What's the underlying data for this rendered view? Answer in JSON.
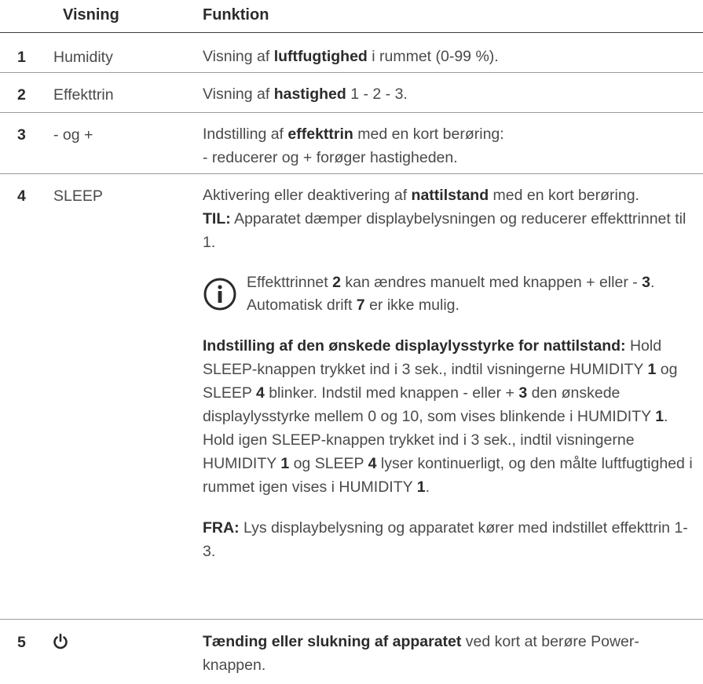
{
  "header": {
    "col_visning": "Visning",
    "col_funktion": "Funktion"
  },
  "rows": [
    {
      "num": "1",
      "visning": "Humidity",
      "f_pre": "Visning af ",
      "f_bold": "luftfugtighed",
      "f_post": " i rummet (0-99 %)."
    },
    {
      "num": "2",
      "visning": "Effekttrin",
      "f_pre": "Visning af ",
      "f_bold": "hastighed",
      "f_post": " 1 - 2 - 3."
    },
    {
      "num": "3",
      "visning": "- og +",
      "f_pre": "Indstilling af ",
      "f_bold": "effekttrin",
      "f_post": " med en kort berøring:",
      "f_line2": "- reducerer og + forøger hastigheden."
    },
    {
      "num": "4",
      "visning": "SLEEP",
      "p1_pre": "Aktivering eller deaktivering af ",
      "p1_bold": "nattilstand",
      "p1_post": " med en kort berøring.",
      "til_label": "TIL:",
      "til_text": " Apparatet dæmper displaybelysningen og reducerer effekttrinnet til 1.",
      "note": {
        "t1": "Effekttrinnet ",
        "b1": "2",
        "t2": " kan ændres manuelt med knappen + eller - ",
        "b2": "3",
        "t3": ". Automatisk drift ",
        "b3": "7",
        "t4": " er ikke mulig."
      },
      "p3_label": "Indstilling af den ønskede displaylysstyrke for nattilstand:",
      "p3": {
        "t1": " Hold SLEEP-knappen trykket ind i 3 sek., indtil visningerne HUMIDITY ",
        "b1": "1",
        "t2": " og SLEEP ",
        "b2": "4",
        "t3": " blinker. Indstil med knappen - eller + ",
        "b3": "3",
        "t4": " den ønskede displaylysstyrke mellem 0 og 10, som vises blinkende i HUMIDITY ",
        "b4": "1",
        "t5": ". Hold igen SLEEP-knappen trykket ind i 3 sek., indtil visningerne HUMIDITY ",
        "b5": "1",
        "t6": " og SLEEP ",
        "b6": "4",
        "t7": " lyser kontinuerligt, og den målte luftfugtighed i rummet igen vises i HUMIDITY ",
        "b7": "1",
        "t8": "."
      },
      "fra_label": "FRA:",
      "fra_text": " Lys displaybelysning og apparatet kører med indstillet effekttrin 1-3."
    },
    {
      "num": "5",
      "visning_icon": "power-icon",
      "f_bold": "Tænding eller slukning af apparatet",
      "f_post": " ved kort at berøre Power-knappen."
    }
  ]
}
